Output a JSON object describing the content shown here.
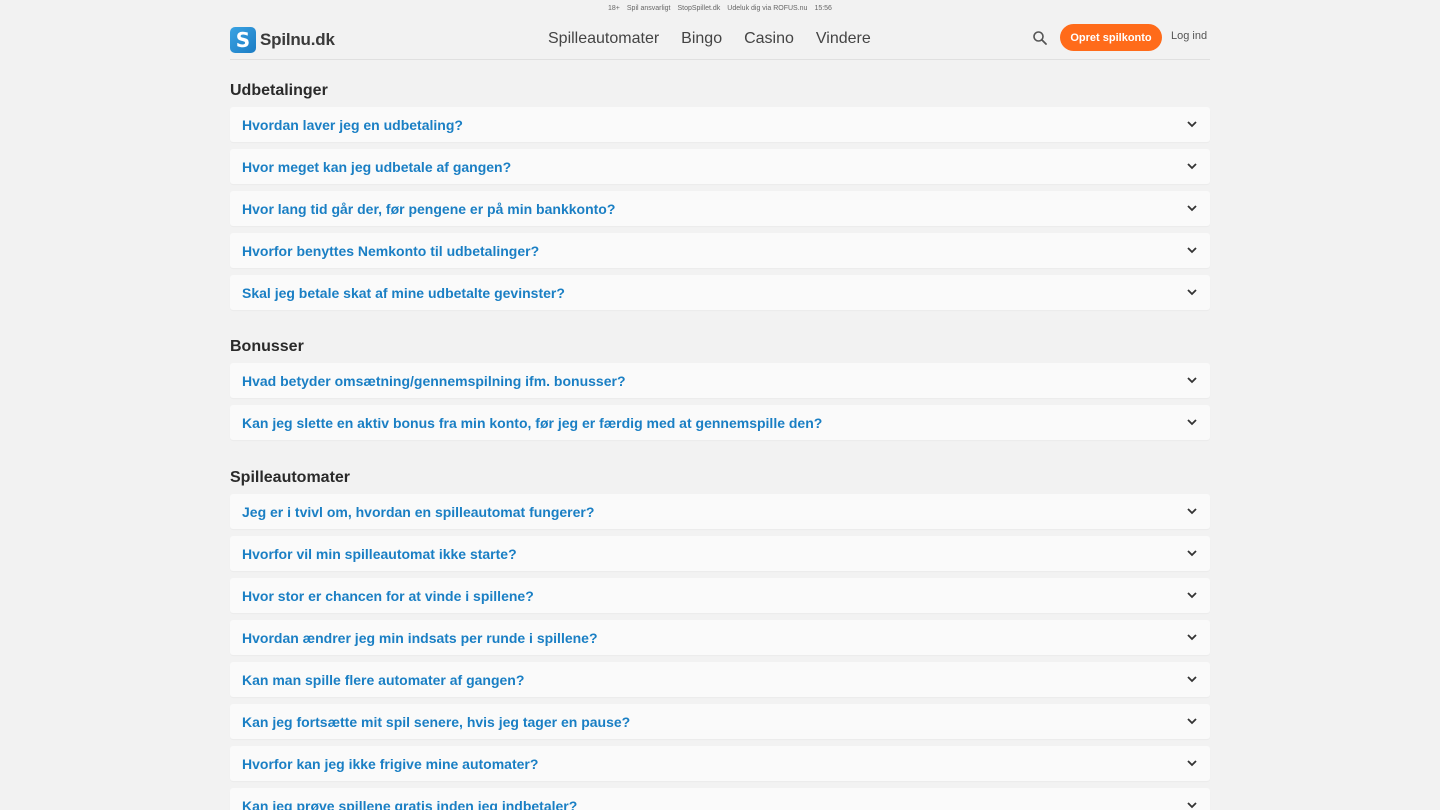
{
  "topbar": {
    "age": "18+",
    "responsible": "Spil ansvarligt",
    "stopspillet": "StopSpillet.dk",
    "rofus": "Udeluk dig via ROFUS.nu",
    "time": "15:56"
  },
  "header": {
    "logo_letter": "S",
    "logo_text": "Spilnu.dk",
    "nav": [
      "Spilleautomater",
      "Bingo",
      "Casino",
      "Vindere"
    ],
    "signup_label": "Opret spilkonto",
    "login_label": "Log ind"
  },
  "colors": {
    "accent": "#ff6b1a",
    "link": "#1a7fc4",
    "brand": "#1b7cc4",
    "background": "#f2f2f2"
  },
  "sections": [
    {
      "title": "Udbetalinger",
      "questions": [
        "Hvordan laver jeg en udbetaling?",
        "Hvor meget kan jeg udbetale af gangen?",
        "Hvor lang tid går der, før pengene er på min bankkonto?",
        "Hvorfor benyttes Nemkonto til udbetalinger?",
        "Skal jeg betale skat af mine udbetalte gevinster?"
      ]
    },
    {
      "title": "Bonusser",
      "questions": [
        "Hvad betyder omsætning/gennemspilning ifm. bonusser?",
        "Kan jeg slette en aktiv bonus fra min konto, før jeg er færdig med at gennemspille den?"
      ]
    },
    {
      "title": "Spilleautomater",
      "questions": [
        "Jeg er i tvivl om, hvordan en spilleautomat fungerer?",
        "Hvorfor vil min spilleautomat ikke starte?",
        "Hvor stor er chancen for at vinde i spillene?",
        "Hvordan ændrer jeg min indsats per runde i spillene?",
        "Kan man spille flere automater af gangen?",
        "Kan jeg fortsætte mit spil senere, hvis jeg tager en pause?",
        "Hvorfor kan jeg ikke frigive mine automater?",
        "Kan jeg prøve spillene gratis inden jeg indbetaler?"
      ]
    }
  ]
}
